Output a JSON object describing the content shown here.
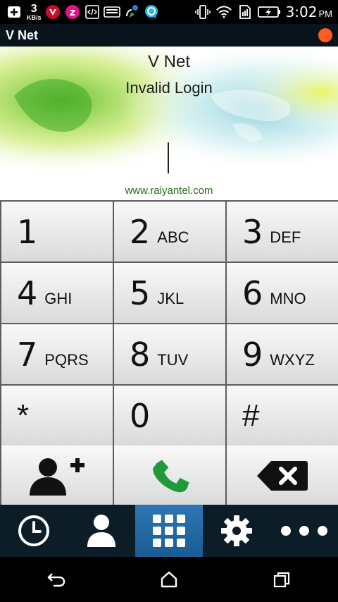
{
  "status_bar": {
    "net_speed_value": "3",
    "net_speed_unit": "KB/s",
    "time": "3:02",
    "ampm": "PM",
    "icons": [
      "add-box-icon",
      "shield-v-icon",
      "circle-z-icon",
      "code-icon",
      "keyboard-icon",
      "wifi-calling-icon",
      "chat-bubble-icon",
      "vibrate-icon",
      "wifi-icon",
      "sim-signal-icon",
      "battery-charging-icon"
    ]
  },
  "app": {
    "title": "V Net",
    "status_color": "#ff5a1f"
  },
  "banner": {
    "brand": "V Net",
    "status": "Invalid Login",
    "input_value": "",
    "website": "www.raiyantel.com"
  },
  "keypad": {
    "keys": [
      {
        "digit": "1",
        "letters": ""
      },
      {
        "digit": "2",
        "letters": "ABC"
      },
      {
        "digit": "3",
        "letters": "DEF"
      },
      {
        "digit": "4",
        "letters": "GHI"
      },
      {
        "digit": "5",
        "letters": "JKL"
      },
      {
        "digit": "6",
        "letters": "MNO"
      },
      {
        "digit": "7",
        "letters": "PQRS"
      },
      {
        "digit": "8",
        "letters": "TUV"
      },
      {
        "digit": "9",
        "letters": "WXYZ"
      },
      {
        "digit": "*",
        "letters": ""
      },
      {
        "digit": "0",
        "letters": ""
      },
      {
        "digit": "#",
        "letters": ""
      }
    ],
    "actions": [
      "add-contact-icon",
      "call-icon",
      "backspace-icon"
    ],
    "call_color": "#1f9a3a"
  },
  "tabs": {
    "items": [
      "history-icon",
      "contacts-icon",
      "dialpad-icon",
      "settings-icon",
      "more-icon"
    ],
    "active_index": 2,
    "active_color": "#2d77b5"
  },
  "nav": {
    "items": [
      "back-icon",
      "home-icon",
      "recents-icon"
    ]
  }
}
